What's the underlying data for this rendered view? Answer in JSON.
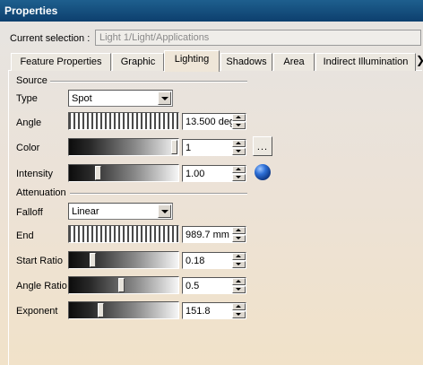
{
  "window": {
    "title": "Properties"
  },
  "selection": {
    "label": "Current selection :",
    "value": "Light 1/Light/Applications"
  },
  "tabs": [
    {
      "label": "Feature Properties",
      "active": false
    },
    {
      "label": "Graphic",
      "active": false
    },
    {
      "label": "Lighting",
      "active": true
    },
    {
      "label": "Shadows",
      "active": false
    },
    {
      "label": "Area",
      "active": false
    },
    {
      "label": "Indirect Illumination",
      "active": false
    }
  ],
  "source": {
    "heading": "Source",
    "type": {
      "label": "Type",
      "value": "Spot"
    },
    "angle": {
      "label": "Angle",
      "value": "13.500 deg"
    },
    "color": {
      "label": "Color",
      "value": "1",
      "button_label": "..."
    },
    "intensity": {
      "label": "Intensity",
      "value": "1.00",
      "slider_fraction": 0.25
    }
  },
  "attenuation": {
    "heading": "Attenuation",
    "falloff": {
      "label": "Falloff",
      "value": "Linear"
    },
    "end": {
      "label": "End",
      "value": "989.7 mm"
    },
    "start_ratio": {
      "label": "Start Ratio",
      "value": "0.18",
      "slider_fraction": 0.2
    },
    "angle_ratio": {
      "label": "Angle Ratio",
      "value": "0.5",
      "slider_fraction": 0.48
    },
    "exponent": {
      "label": "Exponent",
      "value": "151.8",
      "slider_fraction": 0.28
    }
  },
  "colors": {
    "title_bar": "#0d3f6e",
    "accent_sphere": "#2d6fd6"
  }
}
